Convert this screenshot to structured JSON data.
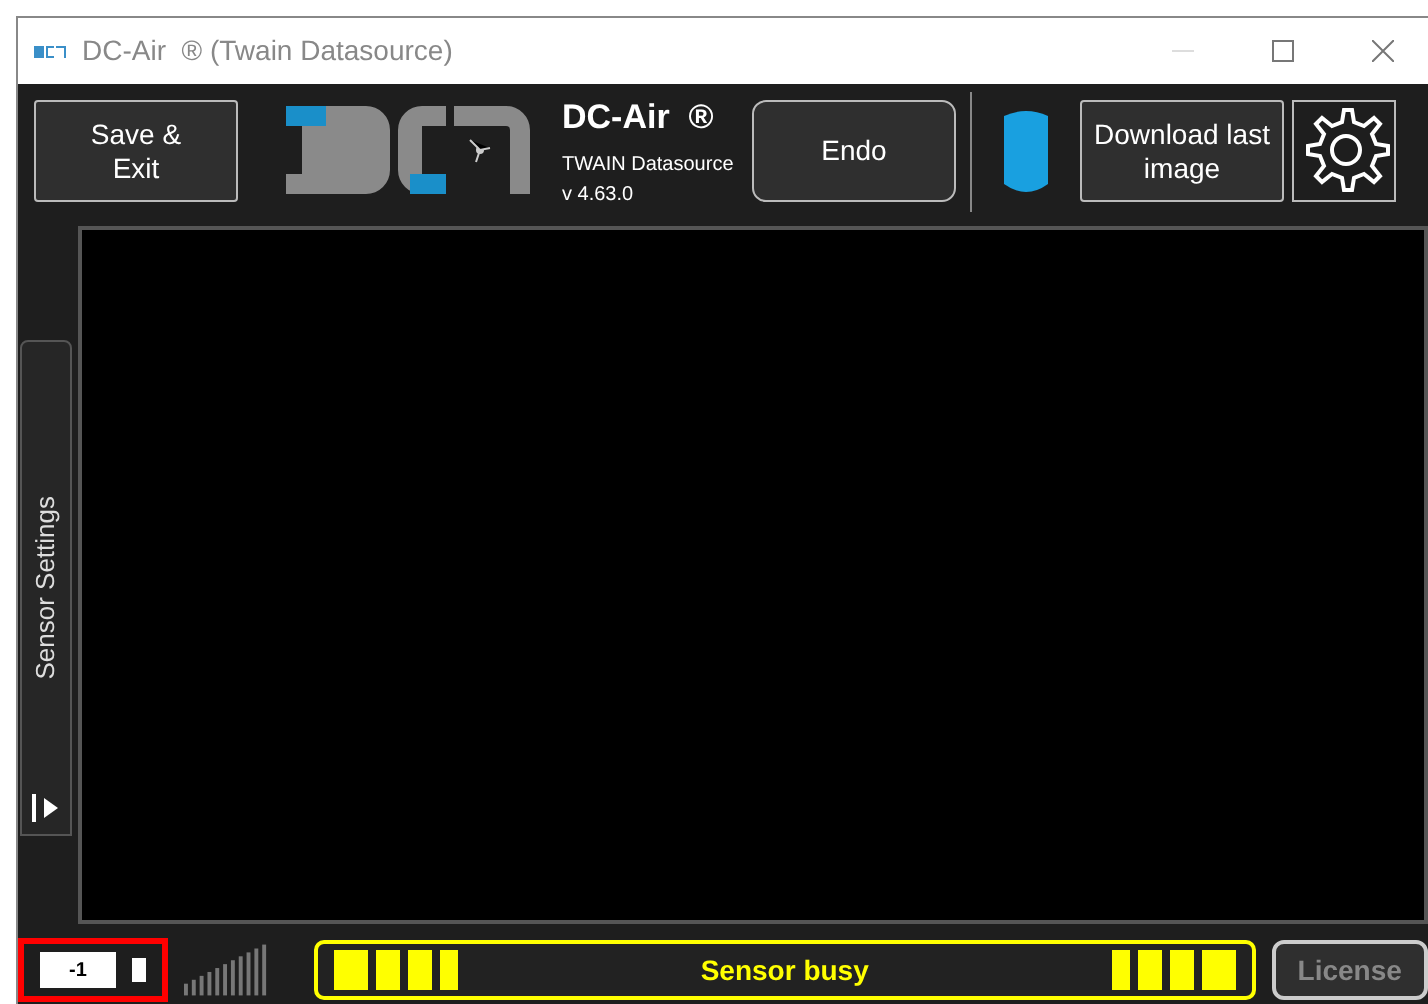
{
  "window": {
    "title": "DC-Air  ® (Twain Datasource)"
  },
  "toolbar": {
    "save_button": "Save &\nExit",
    "product_name": "DC-Air  ®",
    "product_subtitle": "TWAIN Datasource",
    "version": "v 4.63.0",
    "mode_button": "Endo",
    "download_button": "Download last\nimage"
  },
  "side_tab": {
    "label": "Sensor Settings"
  },
  "status_bar": {
    "counter_value": "-1",
    "status_text": "Sensor busy",
    "license_button": "License"
  }
}
